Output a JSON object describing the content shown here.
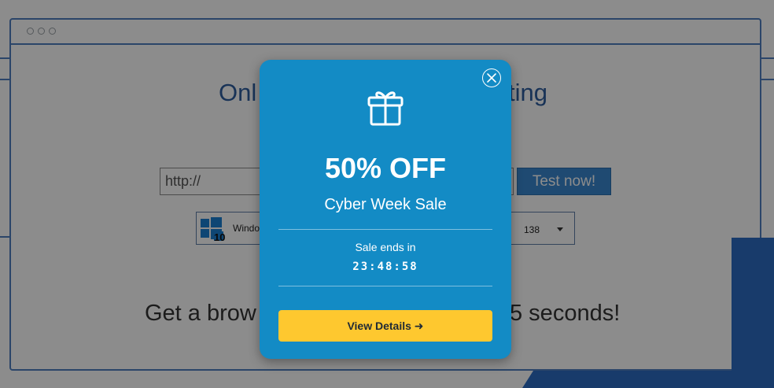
{
  "background": {
    "heading_left": "Onl",
    "heading_right": "ting",
    "url_placeholder": "http://",
    "test_button_label": "Test now!",
    "os_label": "Windo",
    "os_badge": "10",
    "version_label": "138",
    "subtitle_left": "Get a brow",
    "subtitle_right": "5 seconds!"
  },
  "modal": {
    "headline": "50% OFF",
    "subheadline": "Cyber Week Sale",
    "ends_label": "Sale ends in",
    "countdown": "23:48:58",
    "cta_label": "View Details ➜",
    "icons": {
      "close": "close-icon",
      "gift": "gift-icon"
    }
  },
  "colors": {
    "modal_bg": "#138bc5",
    "cta_bg": "#fec82f",
    "accent_blue": "#2d6cc4"
  }
}
